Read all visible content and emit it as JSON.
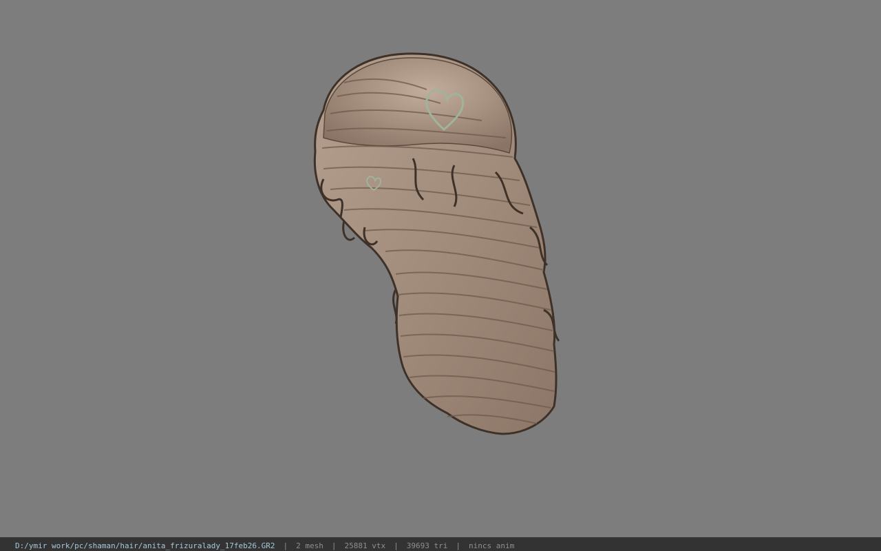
{
  "viewer": {
    "background_color": "#7d7d7d",
    "model_name": "hair-mesh",
    "hair_base_color": "#a6907f",
    "hair_shadow_color": "#3e3128",
    "accessory_color": "#9fb49a"
  },
  "status_bar": {
    "file_path": "D:/ymir work/pc/shaman/hair/anita_frizuralady_17feb26.GR2",
    "separator": "|",
    "mesh_count": "2 mesh",
    "vertex_count": "25881 vtx",
    "triangle_count": "39693 tri",
    "anim_status": "nincs anim"
  }
}
